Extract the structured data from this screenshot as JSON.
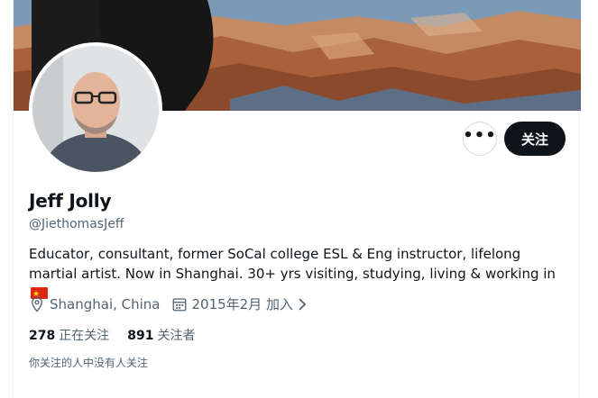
{
  "profile": {
    "name": "Jeff Jolly",
    "handle": "@JiethomasJeff",
    "bio": "Educator, consultant, former SoCal college ESL & Eng instructor, lifelong martial artist. Now in Shanghai. 30+ yrs visiting, studying, living & working in",
    "bio_flag_icon": "china-flag-icon",
    "location": "Shanghai, China",
    "joined": "2015年2月 加入"
  },
  "actions": {
    "more_label": "•••",
    "follow_label": "关注"
  },
  "stats": {
    "following_count": "278",
    "following_label": "正在关注",
    "followers_count": "891",
    "followers_label": "关注者"
  },
  "mutuals_note": "你关注的人中没有人关注",
  "icons": {
    "location": "location-pin-icon",
    "calendar": "calendar-icon",
    "chevron": "chevron-right-icon"
  },
  "colors": {
    "primary_text": "#0f1419",
    "secondary_text": "#536471",
    "follow_button_bg": "#0f1419"
  }
}
